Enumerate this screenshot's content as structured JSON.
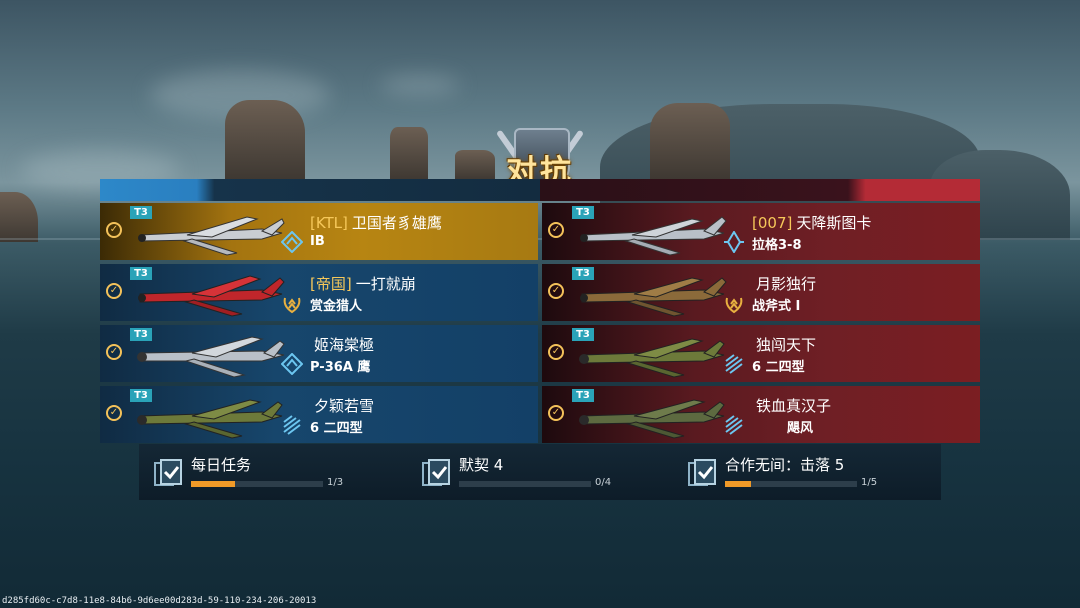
{
  "title": "对抗",
  "teams": {
    "blue_color": "#2a7fc0",
    "red_color": "#b42b36"
  },
  "blue_team": [
    {
      "tier": "T3",
      "clan": "[KTL]",
      "name": "卫国者豸雄鹰",
      "sub": "IB",
      "rank_icon": "diamond-icon",
      "plane_color": "#c9cdd2",
      "highlight": true
    },
    {
      "tier": "T3",
      "clan": "[帝国]",
      "name": "一打就崩",
      "sub": "赏金猎人",
      "rank_icon": "laurel-icon",
      "plane_color": "#c0262b",
      "highlight": false
    },
    {
      "tier": "T3",
      "clan": "",
      "name": "姬海棠極",
      "sub": "P-36A 鹰",
      "rank_icon": "diamond-icon",
      "plane_color": "#b9c0c8",
      "highlight": false
    },
    {
      "tier": "T3",
      "clan": "",
      "name": "夕颖若雪",
      "sub": "6 二四型",
      "rank_icon": "chevrons-icon",
      "plane_color": "#6d7a3a",
      "highlight": false
    }
  ],
  "red_team": [
    {
      "tier": "T3",
      "clan": "[007]",
      "name": "天降斯图卡",
      "sub": "拉格3-8",
      "rank_icon": "crystal-icon",
      "plane_color": "#b9c0c8"
    },
    {
      "tier": "T3",
      "clan": "",
      "name": "月影独行",
      "sub": "战斧式 I",
      "rank_icon": "laurel-icon",
      "plane_color": "#8b6a3a"
    },
    {
      "tier": "T3",
      "clan": "",
      "name": "独闯天下",
      "sub": "6 二四型",
      "rank_icon": "chevrons-icon",
      "plane_color": "#6d7a3a"
    },
    {
      "tier": "T3",
      "clan": "",
      "name": "铁血真汉子",
      "sub": "飓风",
      "rank_icon": "chevrons-icon",
      "plane_color": "#5d6a40"
    }
  ],
  "missions": [
    {
      "label": "每日任务",
      "progress": "1/3",
      "fraction": 0.33
    },
    {
      "label": "默契 4",
      "progress": "0/4",
      "fraction": 0
    },
    {
      "label": "合作无间：击落 5",
      "progress": "1/5",
      "fraction": 0.2
    }
  ],
  "footer_id": "d285fd60c-c7d8-11e8-84b6-9d6ee00d283d-59-110-234-206-20013"
}
